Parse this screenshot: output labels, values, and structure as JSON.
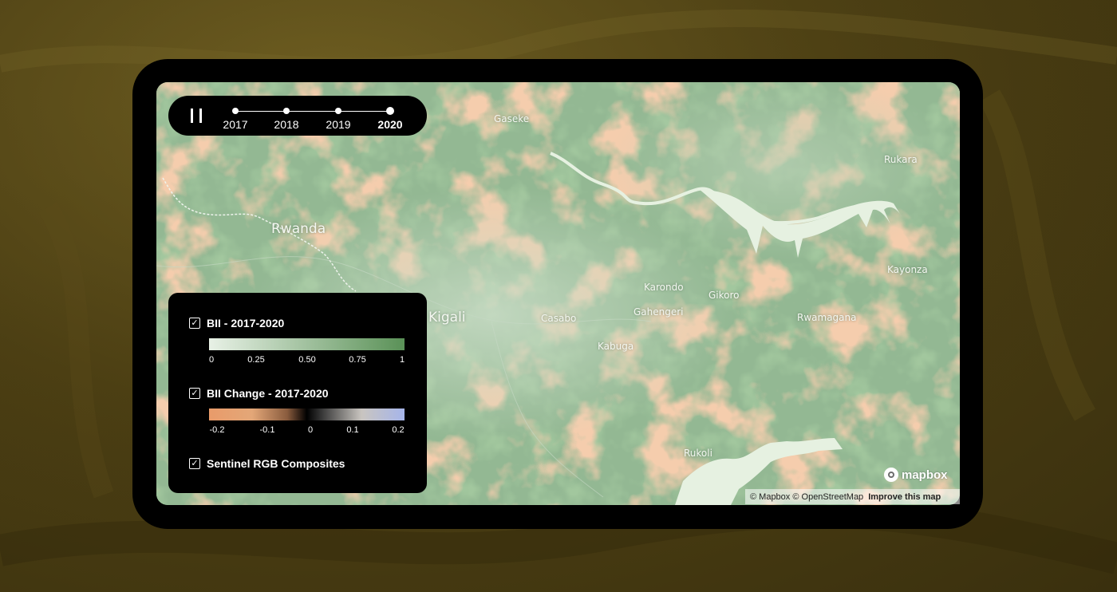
{
  "colors": {
    "background": "#4c3f13",
    "frame": "#000000",
    "bii_high": "#5a9157",
    "bii_low": "#e8f1e6",
    "change_negative": "#e99b6a",
    "change_positive": "#a6b5ea",
    "water": "#e6f1e1"
  },
  "timeline": {
    "play_state_icon": "pause-icon",
    "years": [
      {
        "label": "2017",
        "active": false
      },
      {
        "label": "2018",
        "active": false
      },
      {
        "label": "2019",
        "active": false
      },
      {
        "label": "2020",
        "active": true
      }
    ]
  },
  "map": {
    "places": {
      "rwanda": "Rwanda",
      "kigali": "Kigali",
      "gaseke": "Gaseke",
      "rukara": "Rukara",
      "kayonza": "Kayonza",
      "karondo": "Karondo",
      "gikoro": "Gikoro",
      "gahengeri": "Gahengeri",
      "casabo": "Casabo",
      "kabuga": "Kabuga",
      "rwamagana": "Rwamagana",
      "rukoli": "Rukoli"
    }
  },
  "legend": {
    "layers": [
      {
        "label": "BII - 2017-2020",
        "checked": true,
        "ticks": [
          "0",
          "0.25",
          "0.50",
          "0.75",
          "1"
        ]
      },
      {
        "label": "BII Change - 2017-2020",
        "checked": true,
        "ticks": [
          "-0.2",
          "-0.1",
          "0",
          "0.1",
          "0.2"
        ]
      },
      {
        "label": "Sentinel RGB Composites",
        "checked": true
      }
    ]
  },
  "attribution": {
    "logo": "mapbox",
    "mapbox": "© Mapbox",
    "osm": "© OpenStreetMap",
    "improve": "Improve this map"
  }
}
